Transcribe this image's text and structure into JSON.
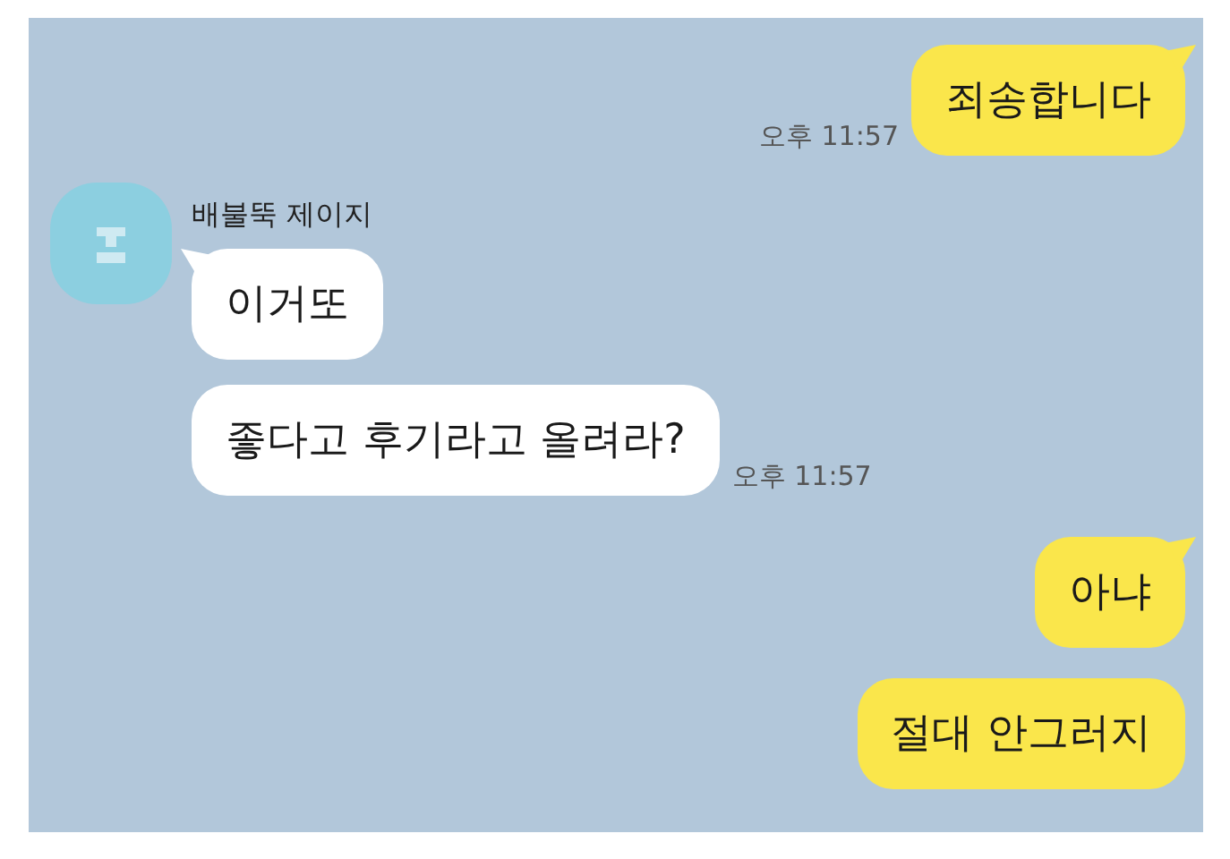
{
  "groups": [
    {
      "outgoing": true,
      "messages": [
        {
          "text": "죄송합니다",
          "time": "오후 11:57"
        }
      ]
    },
    {
      "outgoing": false,
      "sender": "배불뚝 제이지",
      "messages": [
        {
          "text": "이거또"
        },
        {
          "text": "좋다고 후기라고 올려라?",
          "time": "오후 11:57"
        }
      ]
    },
    {
      "outgoing": true,
      "messages": [
        {
          "text": "아냐"
        },
        {
          "text": "절대 안그러지"
        }
      ]
    }
  ]
}
